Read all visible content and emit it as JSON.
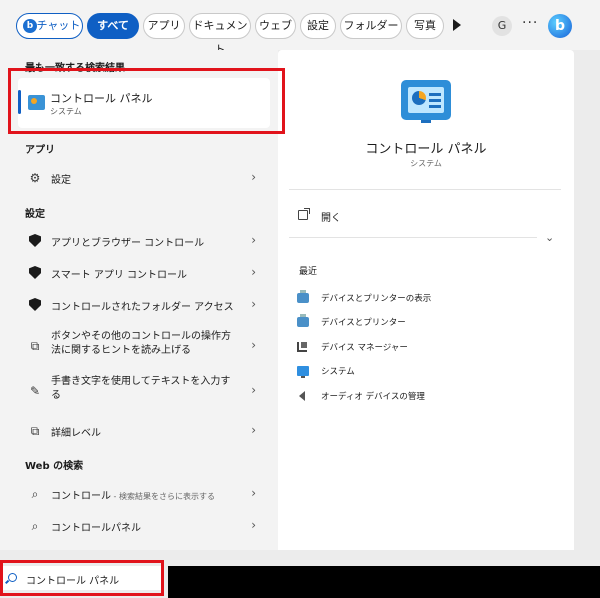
{
  "filters": {
    "chat": "チャット",
    "all": "すべて",
    "apps": "アプリ",
    "documents": "ドキュメント",
    "web": "ウェブ",
    "settings": "設定",
    "folders": "フォルダー",
    "photos": "写真",
    "avatar": "G",
    "more": "···",
    "bing_logo": "b",
    "chat_logo": "b"
  },
  "left": {
    "best_match_heading": "最も一致する検索結果",
    "best_match": {
      "title": "コントロール パネル",
      "subtitle": "システム"
    },
    "apps_heading": "アプリ",
    "apps": [
      {
        "label": "設定"
      }
    ],
    "settings_heading": "設定",
    "settings": [
      {
        "label": "アプリとブラウザー コントロール"
      },
      {
        "label": "スマート アプリ コントロール"
      },
      {
        "label": "コントロールされたフォルダー アクセス"
      },
      {
        "label": "ボタンやその他のコントロールの操作方法に関するヒントを読み上げる"
      },
      {
        "label": "手書き文字を使用してテキストを入力する"
      },
      {
        "label": "詳細レベル"
      }
    ],
    "web_heading": "Web の検索",
    "web": [
      {
        "label": "コントロール",
        "sub": " - 検索結果をさらに表示する"
      },
      {
        "label": "コントロールパネル"
      }
    ],
    "chevron": "›"
  },
  "right": {
    "title": "コントロール パネル",
    "subtitle": "システム",
    "open": "開く",
    "expand": "⌄",
    "recent_heading": "最近",
    "recent": [
      {
        "label": "デバイスとプリンターの表示",
        "icon": "printer-icon"
      },
      {
        "label": "デバイスとプリンター",
        "icon": "printer-icon"
      },
      {
        "label": "デバイス マネージャー",
        "icon": "device-manager-icon"
      },
      {
        "label": "システム",
        "icon": "system-icon"
      },
      {
        "label": "オーディオ デバイスの管理",
        "icon": "audio-icon"
      }
    ]
  },
  "search": {
    "value": "コントロール パネル"
  },
  "colors": {
    "accent": "#0f5fc4",
    "highlight": "#e1131b"
  }
}
